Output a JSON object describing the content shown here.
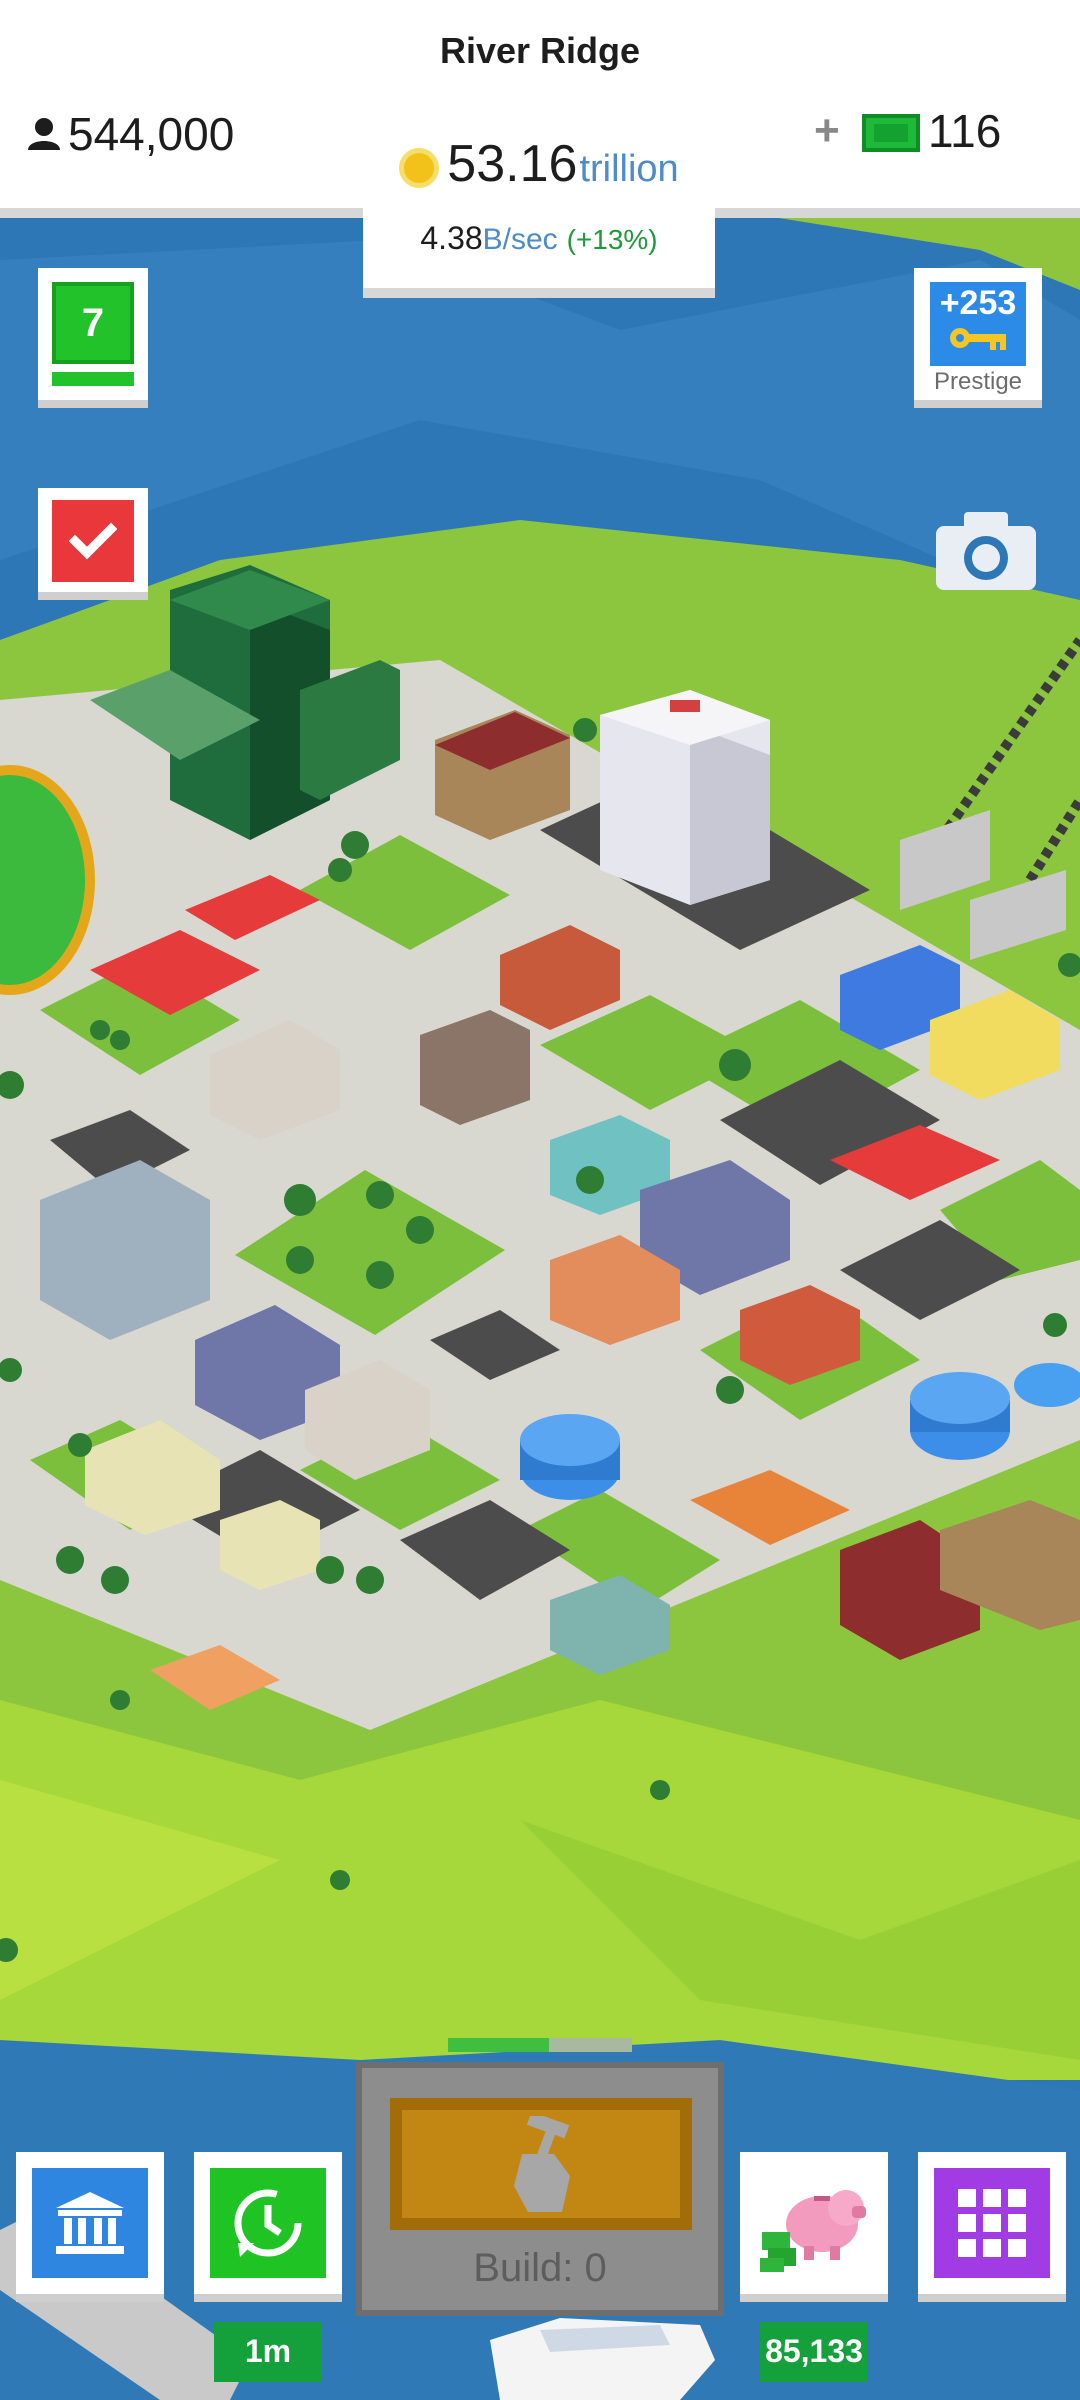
{
  "city": {
    "name": "River Ridge"
  },
  "stats": {
    "population": "544,000",
    "coins": "53.16",
    "coins_unit": "trillion",
    "rate_value": "4.38",
    "rate_unit": "B/sec",
    "rate_bonus": "(+13%)",
    "cash_plus": "+",
    "cash": "116"
  },
  "buttons": {
    "level": "7",
    "prestige_count": "+253",
    "prestige_label": "Prestige",
    "build_label": "Build: 0",
    "time_warp_tag": "1m",
    "savings_tag": "85,133"
  },
  "build_progress": 0.55,
  "colors": {
    "water": "#2d77b6",
    "grass": "#8cc63f",
    "road": "#d8d8d0",
    "coin": "#f2c21a",
    "cash": "#1fb93a",
    "level": "#22c32a",
    "tasks": "#e8383b",
    "prestige": "#2d8be8",
    "bank": "#2e86e0",
    "menu": "#a13be4",
    "build": "#c18712"
  },
  "icons": {
    "population": "person-icon",
    "coins": "coin-icon",
    "cash": "cash-icon",
    "tasks": "checkmark-icon",
    "prestige": "key-icon",
    "camera": "camera-icon",
    "build": "hammer-icon",
    "bank": "bank-icon",
    "time_warp": "clock-icon",
    "savings": "piggy-bank-icon",
    "menu": "grid-icon"
  }
}
